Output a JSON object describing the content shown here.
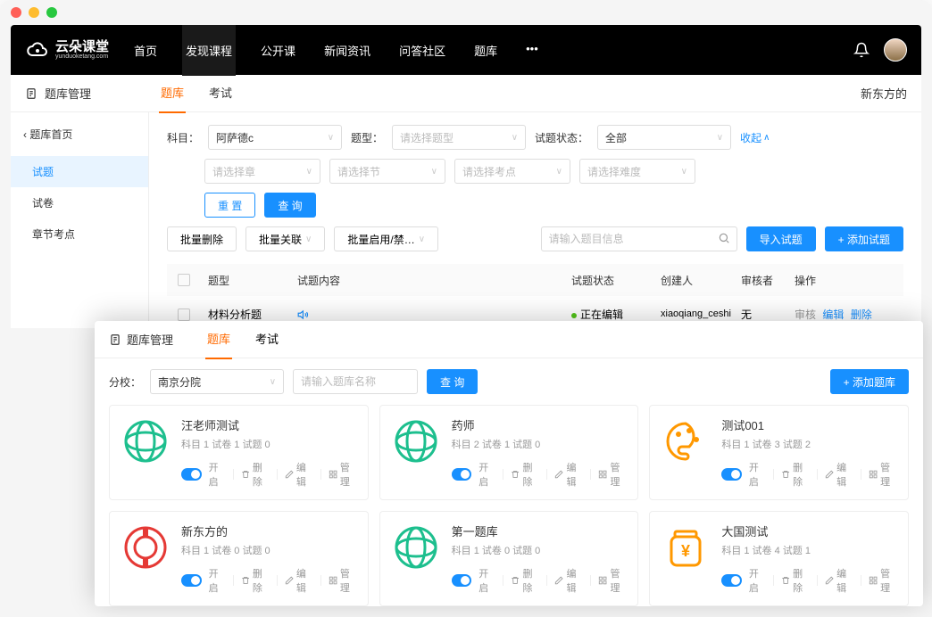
{
  "topnav": {
    "logo_cn": "云朵课堂",
    "logo_en": "yunduoketang.com",
    "links": [
      "首页",
      "发现课程",
      "公开课",
      "新闻资讯",
      "问答社区",
      "题库"
    ],
    "active_index": 1
  },
  "subbar": {
    "breadcrumb_icon": "doc",
    "breadcrumb": "题库管理",
    "tabs": [
      "题库",
      "考试"
    ],
    "active_tab": 0,
    "right_text": "新东方的"
  },
  "sidebar": {
    "back": "题库首页",
    "items": [
      "试题",
      "试卷",
      "章节考点"
    ],
    "active_index": 0
  },
  "filters": {
    "subject_label": "科目：",
    "subject_value": "阿萨德c",
    "type_label": "题型：",
    "type_placeholder": "请选择题型",
    "status_label": "试题状态：",
    "status_value": "全部",
    "collapse": "收起",
    "chapter_placeholder": "请选择章",
    "section_placeholder": "请选择节",
    "point_placeholder": "请选择考点",
    "difficulty_placeholder": "请选择难度",
    "reset": "重 置",
    "query": "查 询"
  },
  "toolbar": {
    "batch_delete": "批量删除",
    "batch_link": "批量关联",
    "batch_toggle": "批量启用/禁…",
    "search_placeholder": "请输入题目信息",
    "import": "导入试题",
    "add": "+ 添加试题"
  },
  "table": {
    "headers": {
      "type": "题型",
      "content": "试题内容",
      "status": "试题状态",
      "creator": "创建人",
      "reviewer": "审核者",
      "ops": "操作"
    },
    "rows": [
      {
        "type": "材料分析题",
        "has_audio": true,
        "status": "正在编辑",
        "creator": "xiaoqiang_ceshi",
        "reviewer": "无",
        "ops": {
          "review": "审核",
          "edit": "编辑",
          "delete": "删除"
        }
      }
    ]
  },
  "panel2": {
    "title": "题库管理",
    "tabs": [
      "题库",
      "考试"
    ],
    "active_tab": 0,
    "branch_label": "分校：",
    "branch_value": "南京分院",
    "name_placeholder": "请输入题库名称",
    "query": "查 询",
    "add": "+ 添加题库"
  },
  "cards": [
    {
      "title": "汪老师测试",
      "meta": "科目 1  试卷 1  试题 0",
      "icon": "globe-green"
    },
    {
      "title": "药师",
      "meta": "科目 2  试卷 1  试题 0",
      "icon": "globe-green"
    },
    {
      "title": "测试001",
      "meta": "科目 1  试卷 3  试题 2",
      "icon": "palette-orange"
    },
    {
      "title": "新东方的",
      "meta": "科目 1  试卷 0  试题 0",
      "icon": "coin-red"
    },
    {
      "title": "第一题库",
      "meta": "科目 1  试卷 0  试题 0",
      "icon": "globe-green"
    },
    {
      "title": "大国测试",
      "meta": "科目 1  试卷 4  试题 1",
      "icon": "jar-orange"
    }
  ],
  "card_ops": {
    "on": "开启",
    "delete": "删除",
    "edit": "编辑",
    "manage": "管理"
  }
}
